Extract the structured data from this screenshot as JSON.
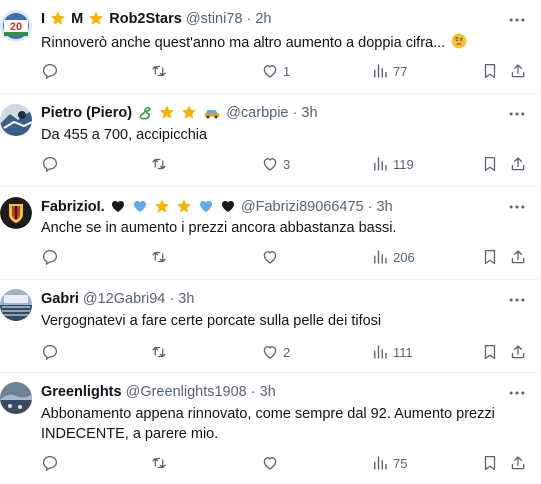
{
  "tweets": [
    {
      "name": "I",
      "name_mid": "M",
      "name_end": "Rob2Stars",
      "handle": "@stini78",
      "dot": "·",
      "time": "2h",
      "text": "Rinnoverò anche quest'anno ma altro aumento a doppia cifra...",
      "replies": "",
      "reposts": "",
      "likes": "1",
      "views": "77"
    },
    {
      "name": "Pietro (Piero)",
      "handle": "@carbpie",
      "dot": "·",
      "time": "3h",
      "text": "Da 455 a 700, accipicchia",
      "replies": "",
      "reposts": "",
      "likes": "3",
      "views": "119"
    },
    {
      "name": "FabrizioI.",
      "handle": "@Fabrizi89066475",
      "dot": "·",
      "time": "3h",
      "text": "Anche se in aumento i prezzi ancora abbastanza bassi.",
      "replies": "",
      "reposts": "",
      "likes": "",
      "views": "206"
    },
    {
      "name": "Gabri",
      "handle": "@12Gabri94",
      "dot": "·",
      "time": "3h",
      "text": "Vergognatevi a fare certe porcate sulla pelle dei tifosi",
      "replies": "",
      "reposts": "",
      "likes": "2",
      "views": "111"
    },
    {
      "name": "Greenlights",
      "handle": "@Greenlights1908",
      "dot": "·",
      "time": "3h",
      "text": "Abbonamento appena rinnovato, come sempre dal 92. Aumento prezzi INDECENTE, a parere mio.",
      "replies": "",
      "reposts": "",
      "likes": "",
      "views": "75"
    }
  ],
  "icons": {
    "more": "more-icon",
    "reply": "reply-icon",
    "repost": "repost-icon",
    "like": "heart-icon",
    "views": "views-icon",
    "bookmark": "bookmark-icon",
    "share": "share-icon"
  },
  "colors": {
    "text": "#0f1419",
    "secondary": "#536471",
    "divider": "#eff3f4",
    "star": "#f4b400",
    "blue_heart": "#5dadec",
    "black_heart": "#1a1a1a"
  }
}
